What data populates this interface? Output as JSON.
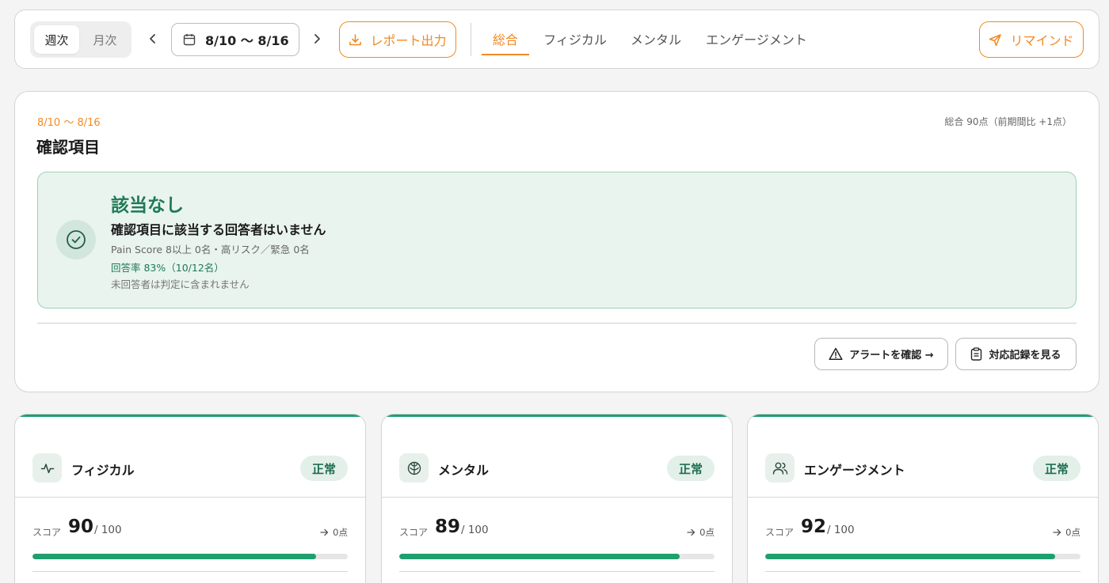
{
  "toolbar": {
    "period_toggle": {
      "weekly": "週次",
      "monthly": "月次",
      "selected": "週次"
    },
    "date_range": "8/10 〜 8/16",
    "export_label": "レポート出力",
    "tabs": [
      {
        "label": "総合",
        "active": true
      },
      {
        "label": "フィジカル",
        "active": false
      },
      {
        "label": "メンタル",
        "active": false
      },
      {
        "label": "エンゲージメント",
        "active": false
      }
    ],
    "remind_label": "リマインド"
  },
  "check_card": {
    "period": "8/10 〜 8/16",
    "summary": "総合 90点（前期間比 +1点）",
    "title": "確認項目",
    "result": {
      "heading": "該当なし",
      "subheading": "確認項目に該当する回答者はいません",
      "criteria": "Pain Score 8以上 0名・高リスク／緊急 0名",
      "response_rate": "回答率 83%（10/12名）",
      "note": "未回答者は判定に含まれません"
    },
    "alert_button": "アラートを確認 →",
    "records_button": "対応記録を見る"
  },
  "score_cards": [
    {
      "title": "フィジカル",
      "icon": "activity-icon",
      "status": "正常",
      "score_label": "スコア",
      "score": 90,
      "max": "/ 100",
      "delta": "0点",
      "progress": 0.9
    },
    {
      "title": "メンタル",
      "icon": "brain-icon",
      "status": "正常",
      "score_label": "スコア",
      "score": 89,
      "max": "/ 100",
      "delta": "0点",
      "progress": 0.89
    },
    {
      "title": "エンゲージメント",
      "icon": "users-icon",
      "status": "正常",
      "score_label": "スコア",
      "score": 92,
      "max": "/ 100",
      "delta": "0点",
      "progress": 0.92
    }
  ],
  "colors": {
    "accent": "#f08a24",
    "success": "#1f9e6e",
    "success_dark": "#1e7a55"
  }
}
